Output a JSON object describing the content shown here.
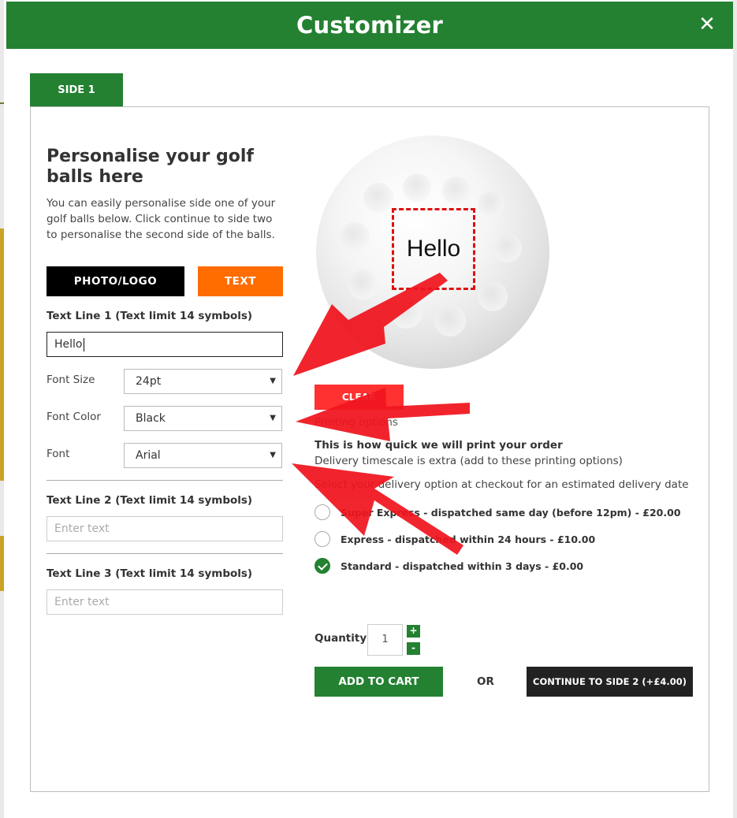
{
  "modal": {
    "title": "Customizer",
    "close_symbol": "✕",
    "tab_label": "SIDE 1"
  },
  "editor": {
    "heading": "Personalise your golf balls here",
    "intro": "You can easily personalise side one of your golf balls below. Click continue to side two to personalise the second side of the balls.",
    "photo_logo_button": "PHOTO/LOGO",
    "text_button": "TEXT",
    "text_line_1": {
      "label": "Text Line 1 (Text limit 14 symbols)",
      "value": "Hello"
    },
    "font_size": {
      "label": "Font Size",
      "value": "24pt"
    },
    "font_color": {
      "label": "Font Color",
      "value": "Black"
    },
    "font": {
      "label": "Font",
      "value": "Arial"
    },
    "text_line_2": {
      "label": "Text Line 2 (Text limit 14 symbols)",
      "placeholder": "Enter text"
    },
    "text_line_3": {
      "label": "Text Line 3 (Text limit 14 symbols)",
      "placeholder": "Enter text"
    }
  },
  "preview": {
    "print_text": "Hello"
  },
  "printing": {
    "clear_button": "CLEAR",
    "options_label": "Printing options",
    "heading": "This is how quick we will print your order",
    "timescale_note": "Delivery timescale is extra (add to these printing options)",
    "delivery_note": "Select your delivery option at checkout for an estimated delivery date",
    "options": [
      {
        "label": "Super Express - dispatched same day (before 12pm) - £20.00",
        "checked": false
      },
      {
        "label": "Express - dispatched within 24 hours - £10.00",
        "checked": false
      },
      {
        "label": "Standard - dispatched within 3 days - £0.00",
        "checked": true
      }
    ]
  },
  "order": {
    "quantity_label": "Quantity",
    "quantity_value": "1",
    "plus": "+",
    "minus": "-",
    "add_to_cart": "ADD TO CART",
    "or": "OR",
    "continue": "CONTINUE TO SIDE 2 (+£4.00)"
  },
  "colors": {
    "brand_green": "#238131",
    "accent_orange": "#ff6c00",
    "clear_red": "#ff3131",
    "annotation_red": "#f0141e"
  }
}
